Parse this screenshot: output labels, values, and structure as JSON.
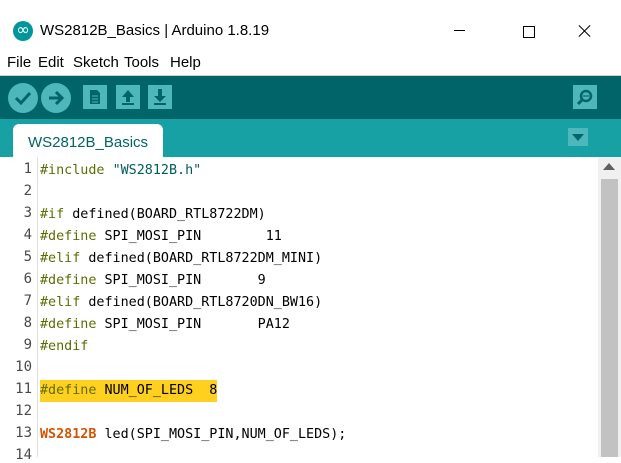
{
  "window": {
    "title": "WS2812B_Basics | Arduino 1.8.19"
  },
  "menu": [
    "File",
    "Edit",
    "Sketch",
    "Tools",
    "Help"
  ],
  "toolbar": {
    "buttons": [
      "verify-icon",
      "upload-icon",
      "new-icon",
      "open-icon",
      "save-icon",
      "serial-monitor-icon"
    ]
  },
  "tabs": {
    "active": "WS2812B_Basics"
  },
  "colors": {
    "toolbar": "#006468",
    "tabbar": "#17a1a5",
    "highlight": "#ffd020"
  },
  "code": {
    "line_numbers": [
      "1",
      "2",
      "3",
      "4",
      "5",
      "6",
      "7",
      "8",
      "9",
      "10",
      "11",
      "12",
      "13",
      "14"
    ],
    "l1_kw": "#include",
    "l1_str": "\"WS2812B.h\"",
    "l3_kw": "#if",
    "l3_rest": " defined(BOARD_RTL8722DM)",
    "l4_kw": "#define",
    "l4_rest": " SPI_MOSI_PIN        11",
    "l5_kw": "#elif",
    "l5_rest": " defined(BOARD_RTL8722DM_MINI)",
    "l6_kw": "#define",
    "l6_rest": " SPI_MOSI_PIN       9",
    "l7_kw": "#elif",
    "l7_rest": " defined(BOARD_RTL8720DN_BW16)",
    "l8_kw": "#define",
    "l8_rest": " SPI_MOSI_PIN       PA12",
    "l9_kw": "#endif",
    "l11_kw": "#define",
    "l11_rest": " NUM_OF_LEDS  8",
    "l13_type": "WS2812B",
    "l13_rest": " led(SPI_MOSI_PIN,NUM_OF_LEDS);"
  }
}
